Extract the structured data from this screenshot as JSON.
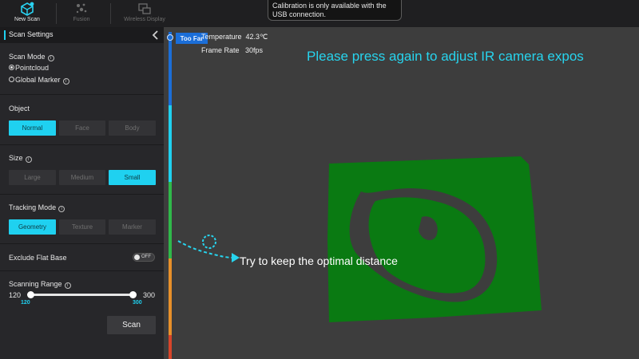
{
  "toolbar": {
    "new_scan": "New Scan",
    "fusion": "Fusion",
    "wireless_display": "Wireless Display"
  },
  "toast": {
    "message": "Calibration is only available with the USB connection."
  },
  "sidebar": {
    "title": "Scan Settings",
    "scan_mode": {
      "label": "Scan Mode",
      "options": [
        "Pointcloud",
        "Global Marker"
      ],
      "selected": "Pointcloud"
    },
    "object": {
      "label": "Object",
      "options": [
        "Normal",
        "Face",
        "Body"
      ],
      "selected": "Normal"
    },
    "size": {
      "label": "Size",
      "options": [
        "Large",
        "Medium",
        "Small"
      ],
      "selected": "Small"
    },
    "tracking_mode": {
      "label": "Tracking Mode",
      "options": [
        "Geometry",
        "Texture",
        "Marker"
      ],
      "selected": "Geometry"
    },
    "exclude_flat_base": {
      "label": "Exclude Flat Base",
      "state": "OFF"
    },
    "scanning_range": {
      "label": "Scanning Range",
      "min_label": "120",
      "max_label": "300",
      "low_value": "120",
      "high_value": "300"
    },
    "scan_button": "Scan"
  },
  "viewport": {
    "distance_indicator": "Too Far",
    "temperature_label": "Temperature",
    "temperature_value": "42.3℃",
    "frame_rate_label": "Frame Rate",
    "frame_rate_value": "30fps",
    "prompt": "Please press again to adjust IR camera expos",
    "hint": "Try to keep the optimal distance"
  },
  "colors": {
    "accent": "#1fd1f0",
    "pointcloud": "#0a7a12",
    "too_far": "#1b6ed8",
    "distance_bar": [
      "#1b6ed8",
      "#1fd1f0",
      "#2fb94a",
      "#e8902a",
      "#d8452a"
    ]
  },
  "icons": {
    "new_scan": "cube-scan-icon",
    "fusion": "sparkle-icon",
    "wireless_display": "screens-icon",
    "collapse": "chevron-left-icon",
    "info": "info-icon",
    "hand_motion": "motion-path-icon"
  }
}
